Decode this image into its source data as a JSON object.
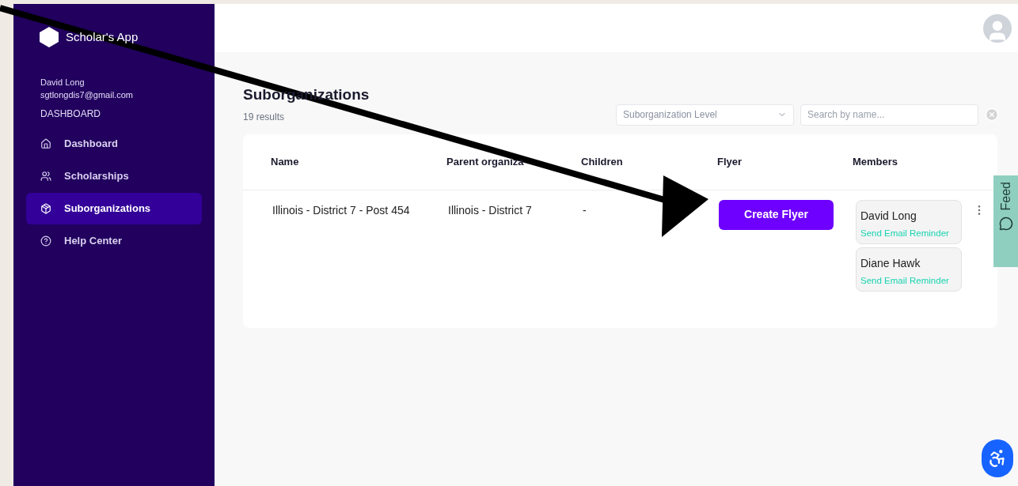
{
  "sidebar": {
    "logo": "Scholar's App",
    "user_name": "David Long",
    "user_email": "sgtlongdis7@gmail.com",
    "section": "DASHBOARD",
    "items": [
      {
        "label": "Dashboard",
        "selected": false
      },
      {
        "label": "Scholarships",
        "selected": false
      },
      {
        "label": "Suborganizations",
        "selected": true
      },
      {
        "label": "Help Center",
        "selected": false
      }
    ]
  },
  "page": {
    "title": "Suborganizations",
    "results": "19 results",
    "level_select": {
      "placeholder": "Suborganization Level"
    },
    "search": {
      "placeholder": "Search by name..."
    }
  },
  "table": {
    "columns": [
      "Name",
      "Parent organiza",
      "Children",
      "Flyer",
      "Members"
    ],
    "rows": [
      {
        "name": "Illinois - District 7 - Post 454",
        "parent": "Illinois - District 7",
        "children": "-",
        "flyer_button": "Create Flyer",
        "members": [
          {
            "name": "David Long",
            "action": "Send Email Reminder"
          },
          {
            "name": "Diane Hawk",
            "action": "Send Email Reminder"
          }
        ]
      }
    ]
  },
  "feedback_tab": "Feed"
}
